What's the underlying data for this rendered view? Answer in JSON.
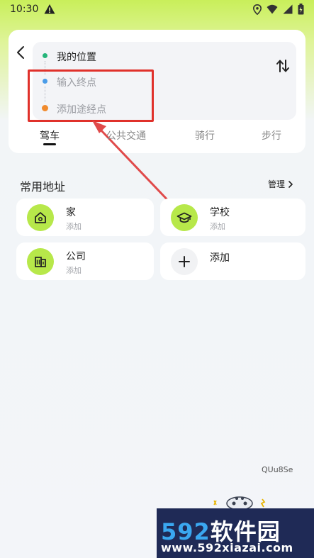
{
  "status_bar": {
    "time": "10:30"
  },
  "route": {
    "origin": "我的位置",
    "destination_placeholder": "输入终点",
    "waypoint_placeholder": "添加途经点"
  },
  "modes": [
    {
      "label": "驾车",
      "active": true
    },
    {
      "label": "公共交通",
      "active": false
    },
    {
      "label": "骑行",
      "active": false
    },
    {
      "label": "步行",
      "active": false
    }
  ],
  "favorites": {
    "title": "常用地址",
    "manage_label": "管理",
    "items": [
      {
        "name": "家",
        "sub": "添加",
        "icon": "home-icon"
      },
      {
        "name": "学校",
        "sub": "添加",
        "icon": "graduation-cap-icon"
      },
      {
        "name": "公司",
        "sub": "添加",
        "icon": "office-building-icon"
      },
      {
        "name": "添加",
        "sub": "",
        "icon": "plus-icon"
      }
    ]
  },
  "watermark": {
    "code": "QUu8Se",
    "logo_digits": "592",
    "logo_text": "软件园",
    "logo_url": "www.592xiazai.com"
  },
  "colors": {
    "accent_green": "#b7e84a",
    "highlight_red": "#e0312b",
    "origin_dot": "#25b57a",
    "destination_dot": "#4a9ce8",
    "waypoint_dot": "#f08a2c"
  }
}
